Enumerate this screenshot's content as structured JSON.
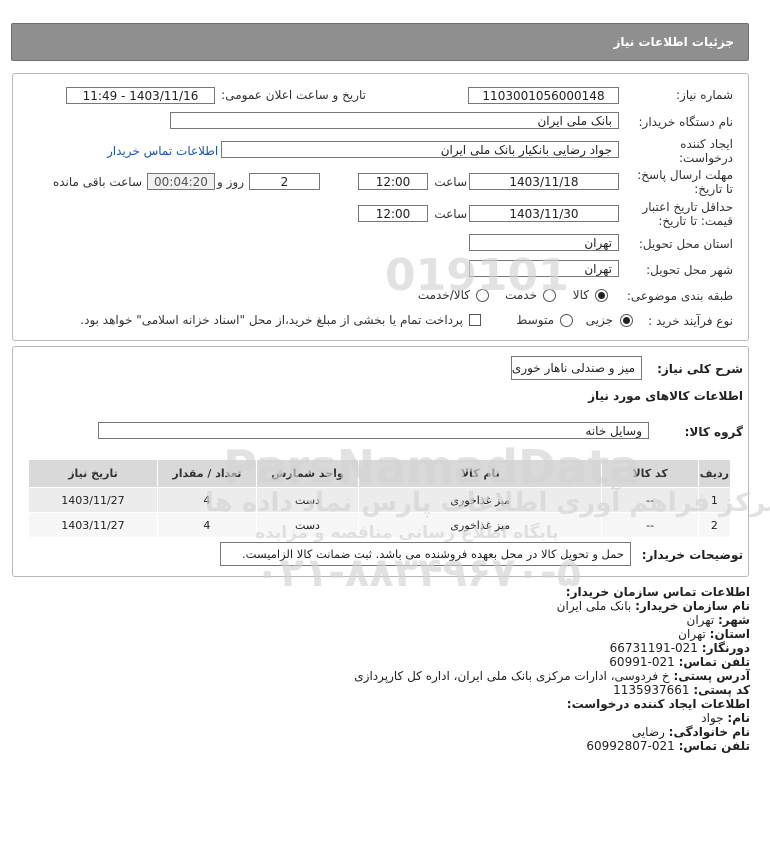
{
  "header": {
    "title": "جزئیات اطلاعات نیاز"
  },
  "form": {
    "need_number_label": "شماره نیاز:",
    "need_number": "1103001056000148",
    "announce_label": "تاریخ و ساعت اعلان عمومی:",
    "announce_value": "1403/11/16 - 11:49",
    "buyer_org_label": "نام دستگاه خریدار:",
    "buyer_org": "بانک ملی ایران",
    "creator_label_1": "ایجاد کننده",
    "creator_label_2": "درخواست:",
    "creator": "جواد رضایی بانکیار بانک ملی ایران",
    "contact_link": "اطلاعات تماس خریدار",
    "deadline_label_1": "مهلت ارسال پاسخ:",
    "deadline_label_2": "تا تاریخ:",
    "deadline_date": "1403/11/18",
    "time_label": "ساعت",
    "deadline_time": "12:00",
    "days": "2",
    "days_label": "روز و",
    "remaining_time": "00:04:20",
    "remaining_label": "ساعت باقی مانده",
    "validity_label_1": "حداقل تاریخ اعتبار",
    "validity_label_2": "قیمت: تا تاریخ:",
    "validity_date": "1403/11/30",
    "validity_time": "12:00",
    "province_label": "استان محل تحویل:",
    "province": "تهران",
    "city_label": "شهر محل تحویل:",
    "city": "تهران",
    "category_label": "طبقه بندی موضوعی:",
    "category_options": [
      "کالا",
      "خدمت",
      "کالا/خدمت"
    ],
    "category_selected": "کالا",
    "process_label": "نوع فرآیند خرید :",
    "process_options": [
      "جزیی",
      "متوسط"
    ],
    "process_selected": "جزیی",
    "treasury_note": "پرداخت تمام یا بخشی از مبلغ خرید،از محل \"اسناد خزانه اسلامی\" خواهد بود."
  },
  "details": {
    "summary_label": "شرح کلی نیاز:",
    "summary": "میز و صندلی ناهار خوری",
    "goods_info_title": "اطلاعات کالاهای مورد نیاز",
    "group_label": "گروه کالا:",
    "group_value": "وسایل خانه",
    "table": {
      "headers": [
        "ردیف",
        "کد کالا",
        "نام کالا",
        "واحد شمارش",
        "تعداد / مقدار",
        "تاریخ نیاز"
      ],
      "rows": [
        [
          "1",
          "--",
          "میز غذاخوری",
          "دست",
          "4",
          "1403/11/27"
        ],
        [
          "2",
          "--",
          "میز غذاخوری",
          "دست",
          "4",
          "1403/11/27"
        ]
      ]
    },
    "buyer_notes_label": "توضیحات خریدار:",
    "buyer_notes": "حمل و تحویل کالا در محل بعهده فروشنده می باشد. ثبت ضمانت کالا الزامیست."
  },
  "contact": {
    "title": "اطلاعات تماس سازمان خریدار:",
    "org_label": "نام سازمان خریدار:",
    "org": "بانک ملی ایران",
    "city_label": "شهر:",
    "city": "تهران",
    "province_label": "استان:",
    "province": "تهران",
    "fax_label": "دورنگار:",
    "fax": "021-66731191",
    "phone_label": "تلفن تماس:",
    "phone": "021-60991",
    "address_label": "آدرس پستی:",
    "address": "خ فردوسی، ادارات مرکزی بانک ملی ایران، اداره کل کارپردازی",
    "postal_label": "کد پستی:",
    "postal": "1135937661",
    "creator_title": "اطلاعات ایجاد کننده درخواست:",
    "name_label": "نام:",
    "name": "جواد",
    "family_label": "نام خانوادگی:",
    "family": "رضایی",
    "creator_phone_label": "تلفن تماس:",
    "creator_phone": "021-60992807"
  },
  "watermark": {
    "brand": "ParsNamadData",
    "code": "019101",
    "line1": "مرکز فراهم آوری اطلاعات پارس نماد داده ها",
    "line2": "پایگاه اطلاع رسانی مناقصه و مزایده",
    "phone": "۰۲۱-۸۸۳۴۹۶۷۰-۵"
  }
}
